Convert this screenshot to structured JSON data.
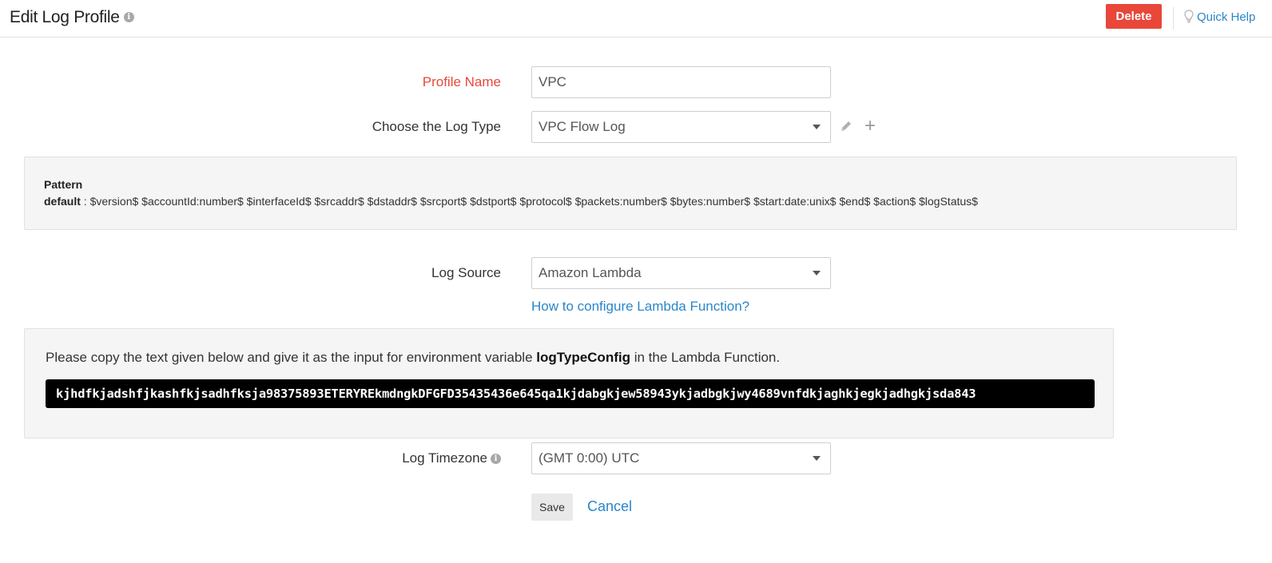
{
  "header": {
    "title": "Edit Log Profile",
    "title_info_icon": "info-icon",
    "delete_label": "Delete",
    "quick_help_label": "Quick Help",
    "quick_help_icon": "lightbulb-icon"
  },
  "form": {
    "profile_name": {
      "label": "Profile Name",
      "value": "VPC",
      "required": true
    },
    "log_type": {
      "label": "Choose the Log Type",
      "selected": "VPC Flow Log",
      "edit_icon": "pencil-icon",
      "add_icon": "plus-icon"
    },
    "pattern": {
      "title": "Pattern",
      "name": "default",
      "separator": " : ",
      "value": "$version$ $accountId:number$ $interfaceId$ $srcaddr$ $dstaddr$ $srcport$ $dstport$ $protocol$ $packets:number$ $bytes:number$ $start:date:unix$ $end$ $action$ $logStatus$"
    },
    "log_source": {
      "label": "Log Source",
      "selected": "Amazon Lambda",
      "help_link": "How to configure Lambda Function?"
    },
    "lambda": {
      "instruction_prefix": "Please copy the text given below and give it as the input for environment variable ",
      "env_var": "logTypeConfig",
      "instruction_suffix": " in the Lambda Function.",
      "config_text": "kjhdfkjadshfjkashfkjsadhfksja98375893ETERYREkmdngkDFGFD35435436e645qa1kjdabgkjew58943ykjadbgkjwy4689vnfdkjaghkjegkjadhgkjsda843"
    },
    "log_timezone": {
      "label": "Log Timezone",
      "info_icon": "info-icon",
      "selected": "(GMT 0:00) UTC"
    },
    "actions": {
      "save_label": "Save",
      "cancel_label": "Cancel"
    }
  },
  "colors": {
    "danger": "#e8473a",
    "link": "#2a86c8",
    "panel_bg": "#f5f5f5",
    "code_bg": "#000000"
  }
}
